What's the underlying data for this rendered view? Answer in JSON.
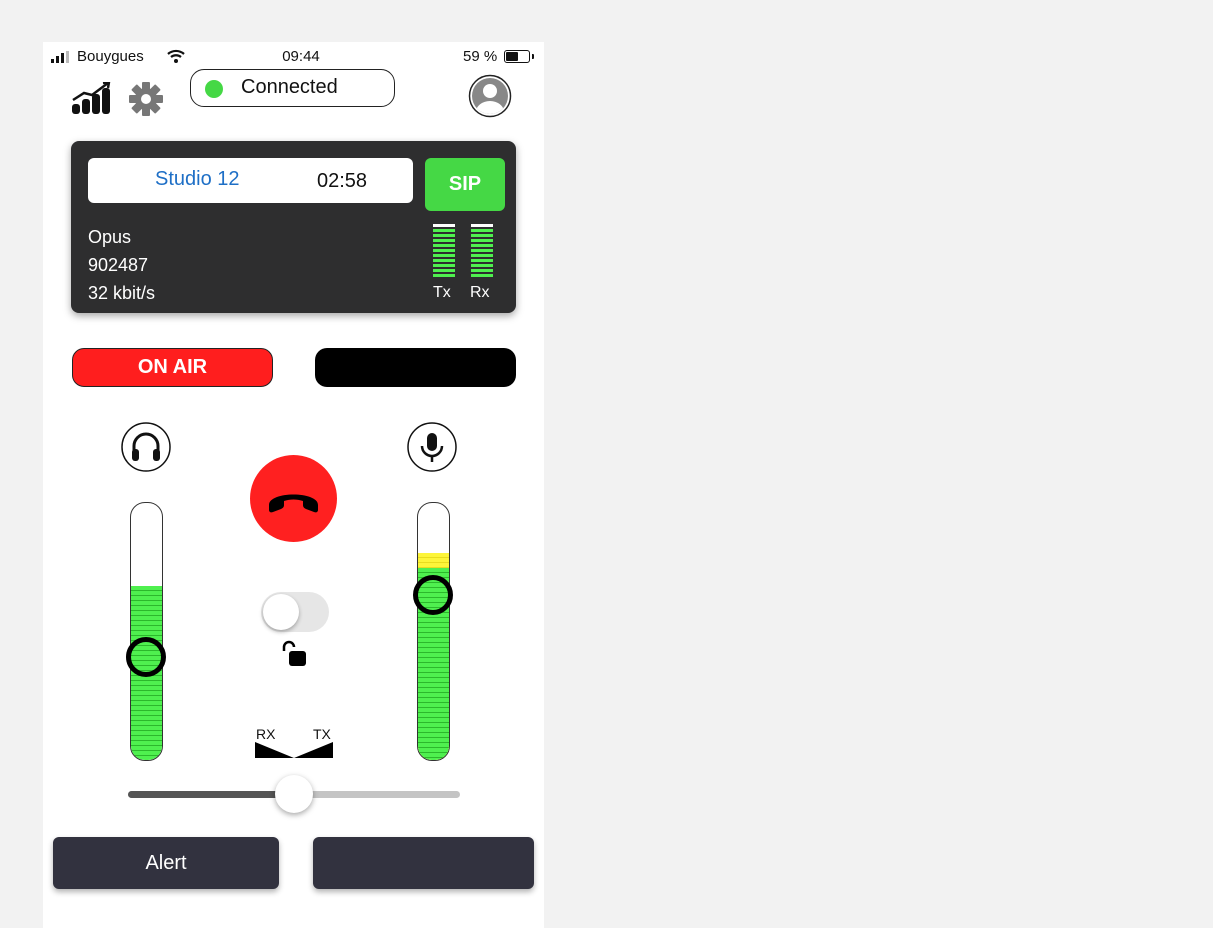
{
  "status_bar": {
    "carrier": "Bouygues",
    "time": "09:44",
    "battery_percent": "59 %",
    "battery_level": 0.59
  },
  "header": {
    "connection_label": "Connected",
    "connection_color": "#45d845",
    "icons": [
      "stats-icon",
      "gear-icon",
      "profile-icon"
    ]
  },
  "session": {
    "studio_name": "Studio 12",
    "timer": "02:58",
    "protocol_button": "SIP",
    "codec": "Opus",
    "id": "902487",
    "bitrate": "32 kbit/s",
    "tx_label": "Tx",
    "rx_label": "Rx"
  },
  "on_air": {
    "label": "ON AIR",
    "color": "#ff1e1e"
  },
  "levels": {
    "headphone_level": 0.67,
    "headphone_knob": 0.4,
    "mic_level": 0.8,
    "mic_peak_level": 0.8,
    "mic_knob": 0.64
  },
  "hangup": {
    "icon": "phone-hangup-icon",
    "color": "#ff2020"
  },
  "lock": {
    "toggle_on": false,
    "icon": "unlock-icon"
  },
  "balance": {
    "rx_label": "RX",
    "tx_label": "TX",
    "value": 0.5
  },
  "bottom_buttons": {
    "alert_label": "Alert",
    "second_label": ""
  }
}
